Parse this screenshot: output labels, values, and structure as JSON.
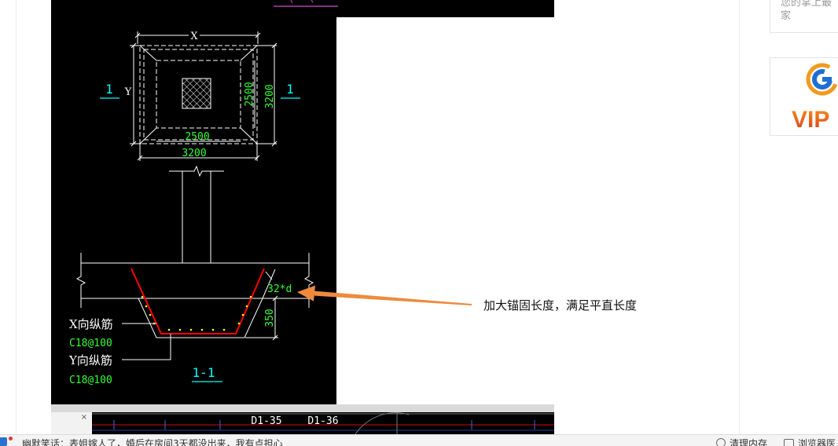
{
  "cad_figure": {
    "plan_view": {
      "dim_x_label": "X",
      "dim_y_label": "Y",
      "inner_dim_vertical": "2500",
      "outer_dim_vertical": "3200",
      "inner_dim_horizontal": "2500",
      "outer_dim_horizontal": "3200",
      "section_mark_left": "1",
      "section_mark_right": "1"
    },
    "section_view": {
      "anchorage_label": "32*d",
      "depth_label": "350",
      "x_rebar_name": "X向纵筋",
      "x_rebar_spec": "C18@100",
      "y_rebar_name": "Y向纵筋",
      "y_rebar_spec": "C18@100",
      "section_title": "1-1"
    },
    "colors": {
      "background": "#000000",
      "lines": "#ffffff",
      "dimension_text": "#33ff33",
      "section_mark": "#00ffff",
      "rebar": "#ff0000",
      "rebar_dots": "#ffff00",
      "heading_underline": "#b23cb2"
    }
  },
  "annotation": {
    "text": "加大锚固长度，满足平直长度",
    "arrow_color": "#ef8a3c"
  },
  "cad_strip": {
    "close_glyph": "×",
    "axis_labels": [
      "D1-35",
      "D1-36"
    ]
  },
  "sidebar": {
    "card_text_line1": "您的掌上最",
    "card_text_line2": "家",
    "vip_logo_text": "VIP",
    "vip_logo_icon": "g-circle-logo-icon"
  },
  "status_bar": {
    "left_icon": "zhidao-icon",
    "news_text": "幽默笑话：表姐嫁人了，婚后在房间3天都没出来，我有点担心",
    "clean_memory_icon": "clean-memory-icon",
    "clean_memory_label": "清理内存",
    "browser_doctor_icon": "browser-doctor-icon",
    "browser_doctor_label": "浏览器医"
  }
}
